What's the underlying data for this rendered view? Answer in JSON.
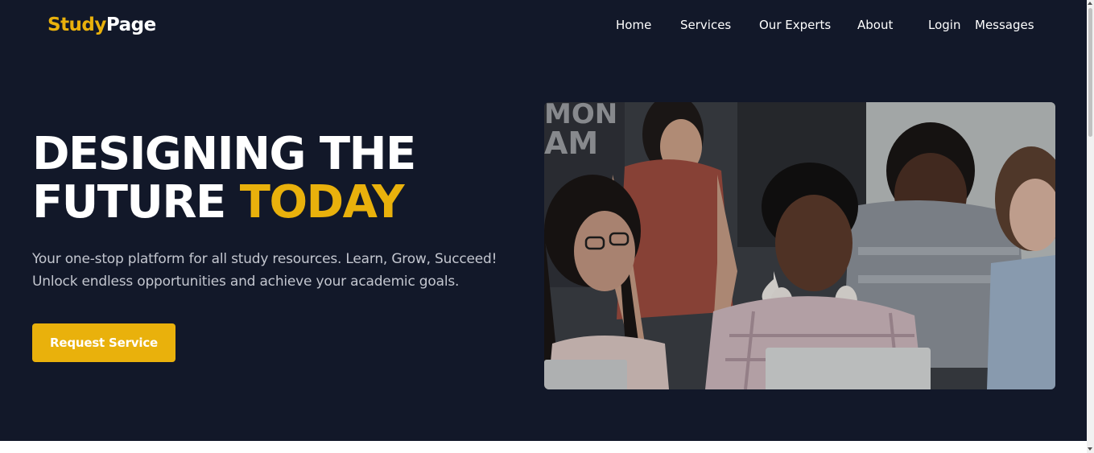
{
  "brand": {
    "part1": "Study",
    "part2": "Page"
  },
  "nav": {
    "home": "Home",
    "services": "Services",
    "experts": "Our Experts",
    "about": "About",
    "login": "Login",
    "messages": "Messages"
  },
  "hero": {
    "headline_line1": "DESIGNING THE",
    "headline_line2_white": "FUTURE ",
    "headline_line2_accent": "TODAY",
    "subtitle_line1": "Your one-stop platform for all study resources. Learn, Grow, Succeed!",
    "subtitle_line2": "Unlock endless opportunities and achieve your academic goals.",
    "cta_label": "Request Service",
    "photo_wall_text_line1": "MON",
    "photo_wall_text_line2": "AM"
  },
  "colors": {
    "background": "#121829",
    "accent": "#e9b10c",
    "text": "#ffffff",
    "subtitle": "#c3c6cf"
  }
}
